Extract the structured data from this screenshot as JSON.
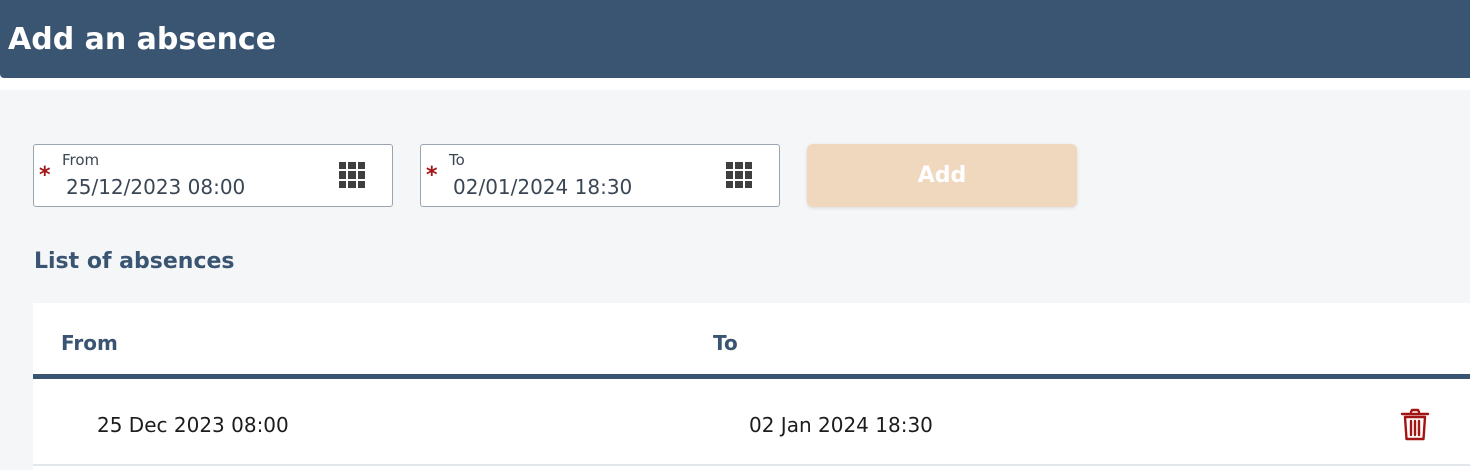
{
  "header": {
    "title": "Add an absence"
  },
  "form": {
    "from": {
      "label": "From",
      "value": "25/12/2023 08:00",
      "required_mark": "*"
    },
    "to": {
      "label": "To",
      "value": "02/01/2024 18:30",
      "required_mark": "*"
    },
    "add_label": "Add"
  },
  "list": {
    "title": "List of absences",
    "columns": {
      "from": "From",
      "to": "To"
    },
    "rows": [
      {
        "from": "25 Dec 2023 08:00",
        "to": "02 Jan 2024 18:30"
      }
    ]
  },
  "icons": {
    "calendar": "calendar-grid-icon",
    "delete": "trash-icon"
  },
  "colors": {
    "header": "#3a5572",
    "accent": "#3a5572",
    "add_button_disabled": "#f0d8bf",
    "delete": "#a31515",
    "required": "#a31515"
  }
}
